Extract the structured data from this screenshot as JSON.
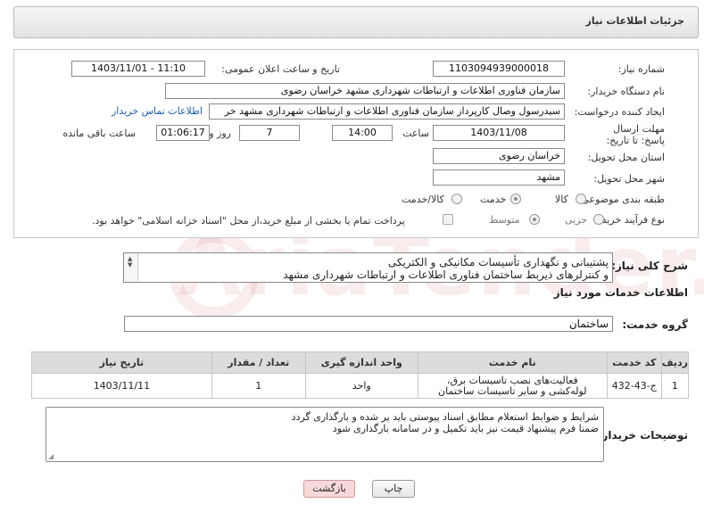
{
  "page": {
    "title": "جزئیات اطلاعات نیاز"
  },
  "form": {
    "need_number_label": "شماره نیاز:",
    "need_number": "1103094939000018",
    "announce_label": "تاریخ و ساعت اعلان عمومی:",
    "announce_value": "1403/11/01 - 11:10",
    "buyer_org_label": "نام دستگاه خریدار:",
    "buyer_org": "سازمان فناوری اطلاعات و ارتباطات شهرداری مشهد خراسان رضوی",
    "requester_label": "ایجاد کننده درخواست:",
    "requester": "سیدرسول وصال کارپرداز سازمان فناوری اطلاعات و ارتباطات شهرداری مشهد خر",
    "contact_link": "اطلاعات تماس خریدار",
    "deadline_label": "مهلت ارسال پاسخ: تا تاریخ:",
    "deadline_date": "1403/11/08",
    "time_label": "ساعت",
    "deadline_time": "14:00",
    "days_value": "7",
    "days_label": "روز و",
    "remaining_time": "01:06:17",
    "remaining_label": "ساعت باقی مانده",
    "province_label": "استان محل تحویل:",
    "province": "خراسان رضوی",
    "city_label": "شهر محل تحویل:",
    "city": "مشهد",
    "category_label": "طبقه بندی موضوعی:",
    "category_options": [
      "کالا",
      "خدمت",
      "کالا/خدمت"
    ],
    "category_selected": "خدمت",
    "process_label": "نوع فرآیند خرید :",
    "process_options": [
      "جزیی",
      "متوسط"
    ],
    "process_selected": "متوسط",
    "payment_note": "پرداخت تمام یا بخشی از مبلغ خرید،از محل \"اسناد خزانه اسلامی\" خواهد بود."
  },
  "summary": {
    "label": "شرح کلی نیاز:",
    "line1": "پشتیبانی و نگهداری تأسیسات مکانیکی و الکتریکی",
    "line2": "و کنترلرهای ذیربط ساختمان فناوری اطلاعات و ارتباطات شهرداری مشهد"
  },
  "services": {
    "section_title": "اطلاعات خدمات مورد نیاز",
    "group_label": "گروه خدمت:",
    "group_value": "ساختمان",
    "columns": [
      "ردیف",
      "کد خدمت",
      "نام خدمت",
      "واحد اندازه گیری",
      "تعداد / مقدار",
      "تاریخ نیاز"
    ],
    "rows": [
      {
        "index": "1",
        "code": "ج-43-432",
        "name": "فعالیت‌های نصب تاسیسات برق، لوله‌کشی و سایر تاسیسات ساختمان",
        "unit": "واحد",
        "qty": "1",
        "date": "1403/11/11"
      }
    ]
  },
  "buyer_notes": {
    "label": "توضیحات خریدار:",
    "line1": "شرایط و ضوابط استعلام مطابق اسناد پیوستی باید پر شده و بارگذاری گردد",
    "line2": "ضمنا فرم پیشنهاد قیمت نیز  باید تکمیل و در سامانه بارگذاری شود"
  },
  "buttons": {
    "print": "چاپ",
    "back": "بازگشت"
  },
  "watermark": "AriaTender.neT"
}
